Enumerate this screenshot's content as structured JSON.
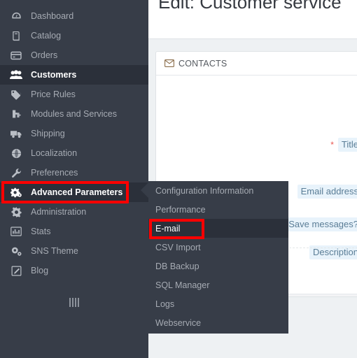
{
  "sidebar": {
    "items": [
      {
        "label": "Dashboard",
        "icon": "dashboard-icon",
        "state": "normal"
      },
      {
        "label": "Catalog",
        "icon": "catalog-icon",
        "state": "normal"
      },
      {
        "label": "Orders",
        "icon": "orders-icon",
        "state": "normal"
      },
      {
        "label": "Customers",
        "icon": "customers-icon",
        "state": "active"
      },
      {
        "label": "Price Rules",
        "icon": "tag-icon",
        "state": "normal"
      },
      {
        "label": "Modules and Services",
        "icon": "modules-icon",
        "state": "normal"
      },
      {
        "label": "Shipping",
        "icon": "truck-icon",
        "state": "normal"
      },
      {
        "label": "Localization",
        "icon": "globe-icon",
        "state": "normal"
      },
      {
        "label": "Preferences",
        "icon": "wrench-icon",
        "state": "normal"
      },
      {
        "label": "Advanced Parameters",
        "icon": "cogs-icon",
        "state": "selected"
      },
      {
        "label": "Administration",
        "icon": "gear-icon",
        "state": "normal"
      },
      {
        "label": "Stats",
        "icon": "chart-bar-icon",
        "state": "normal"
      },
      {
        "label": "SNS Theme",
        "icon": "cogs-icon",
        "state": "normal"
      },
      {
        "label": "Blog",
        "icon": "pencil-icon",
        "state": "normal"
      }
    ],
    "collapse_handle": "collapse-sidebar-handle"
  },
  "submenu": {
    "parent": "Advanced Parameters",
    "items": [
      {
        "label": "Configuration Information",
        "state": "normal"
      },
      {
        "label": "Performance",
        "state": "normal"
      },
      {
        "label": "E-mail",
        "state": "hover"
      },
      {
        "label": "CSV Import",
        "state": "normal"
      },
      {
        "label": "DB Backup",
        "state": "normal"
      },
      {
        "label": "SQL Manager",
        "state": "normal"
      },
      {
        "label": "Logs",
        "state": "normal"
      },
      {
        "label": "Webservice",
        "state": "normal"
      }
    ]
  },
  "main": {
    "page_title": "Edit: Customer service",
    "panel": {
      "header_icon": "envelope-icon",
      "header_title": "CONTACTS",
      "fields": [
        {
          "label": "Title",
          "required_marker": "*"
        },
        {
          "label": "Email address",
          "required_marker": ""
        },
        {
          "label": "Save messages?",
          "required_marker": ""
        },
        {
          "label": "Description",
          "required_marker": ""
        }
      ]
    }
  },
  "annotations": {
    "color": "#ff0000",
    "boxes": [
      {
        "target": "Advanced Parameters"
      },
      {
        "target": "E-mail"
      }
    ]
  }
}
